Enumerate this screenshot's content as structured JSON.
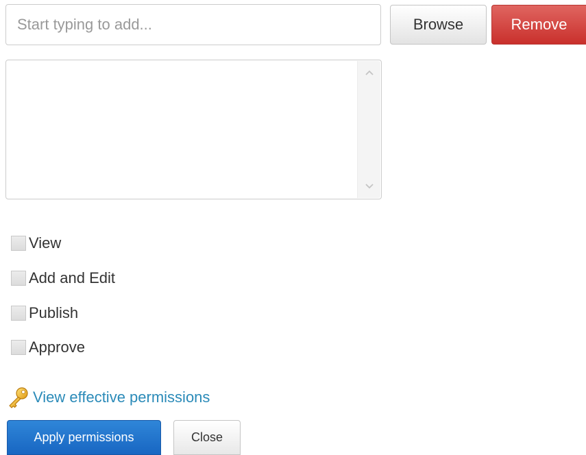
{
  "search": {
    "placeholder": "Start typing to add...",
    "value": ""
  },
  "buttons": {
    "browse": "Browse",
    "remove": "Remove",
    "apply": "Apply permissions",
    "close": "Close"
  },
  "listbox": {
    "items": []
  },
  "permissions": [
    {
      "label": "View",
      "checked": false
    },
    {
      "label": "Add and Edit",
      "checked": false
    },
    {
      "label": "Publish",
      "checked": false
    },
    {
      "label": "Approve",
      "checked": false
    }
  ],
  "links": {
    "effective_permissions": "View effective permissions"
  },
  "icons": {
    "key": "key-icon",
    "scroll_up": "chevron-up-icon",
    "scroll_down": "chevron-down-icon"
  },
  "colors": {
    "remove": "#c9302c",
    "apply": "#1866c2",
    "link": "#2a8ab8",
    "key": "#e8a317"
  }
}
